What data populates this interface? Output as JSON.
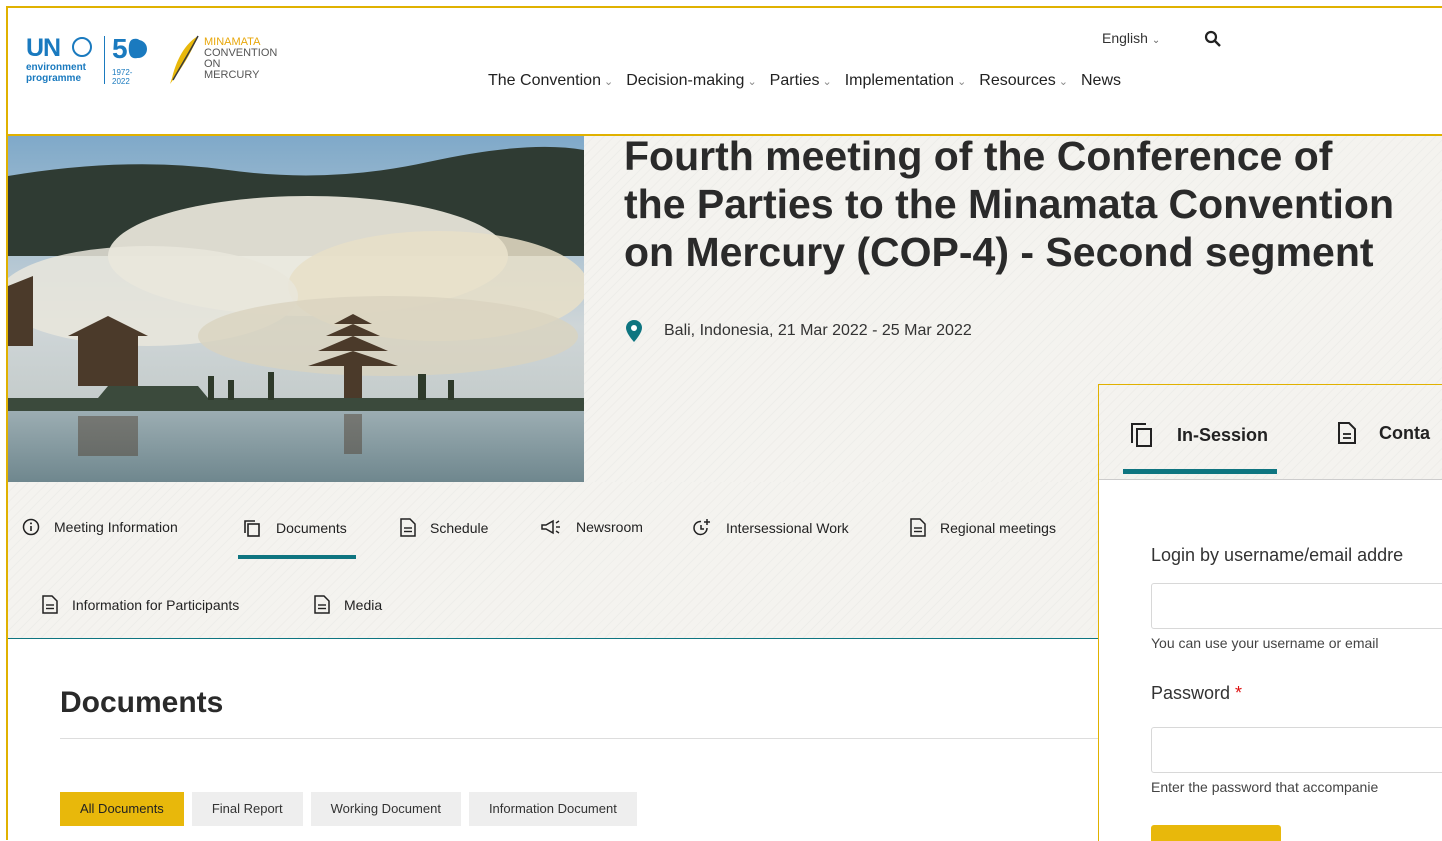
{
  "header": {
    "logo": {
      "un": "UN",
      "un_sub_1": "environment",
      "un_sub_2": "programme",
      "fifty": "50",
      "years": "1972-2022",
      "mina_1": "MINAMATA",
      "mina_2": "CONVENTION",
      "mina_3": "ON MERCURY"
    },
    "language": "English",
    "nav": [
      {
        "label": "The Convention",
        "dropdown": true
      },
      {
        "label": "Decision-making",
        "dropdown": true
      },
      {
        "label": "Parties",
        "dropdown": true
      },
      {
        "label": "Implementation",
        "dropdown": true
      },
      {
        "label": "Resources",
        "dropdown": true
      },
      {
        "label": "News",
        "dropdown": false
      }
    ]
  },
  "hero": {
    "title_line1": "Fourth meeting of the Conference of",
    "title_line2": "the Parties to the Minamata Convention",
    "title_line3": "on Mercury (COP-4) - Second segment",
    "location": "Bali, Indonesia, 21 Mar 2022 - 25 Mar 2022"
  },
  "meeting_tabs": [
    {
      "label": "Meeting Information",
      "icon": "info-icon"
    },
    {
      "label": "Documents",
      "icon": "copy-icon",
      "active": true
    },
    {
      "label": "Schedule",
      "icon": "file-icon"
    },
    {
      "label": "Newsroom",
      "icon": "megaphone-icon"
    },
    {
      "label": "Intersessional Work",
      "icon": "clock-plus-icon"
    },
    {
      "label": "Regional meetings",
      "icon": "file-icon"
    },
    {
      "label": "Information for Participants",
      "icon": "file-icon"
    },
    {
      "label": "Media",
      "icon": "file-icon"
    }
  ],
  "documents": {
    "heading": "Documents",
    "filters": [
      {
        "label": "All Documents",
        "active": true
      },
      {
        "label": "Final Report"
      },
      {
        "label": "Working Document"
      },
      {
        "label": "Information Document"
      }
    ]
  },
  "login_panel": {
    "tabs": [
      {
        "label": "In-Session",
        "active": true
      },
      {
        "label": "Conta"
      }
    ],
    "username_label": "Login by username/email addre",
    "username_help": "You can use your username or email",
    "password_label": "Password",
    "password_required": "*",
    "password_help": "Enter the password that accompanie"
  },
  "colors": {
    "accent_gold": "#e8b80b",
    "teal": "#0e7580",
    "un_blue": "#1a7abf"
  }
}
